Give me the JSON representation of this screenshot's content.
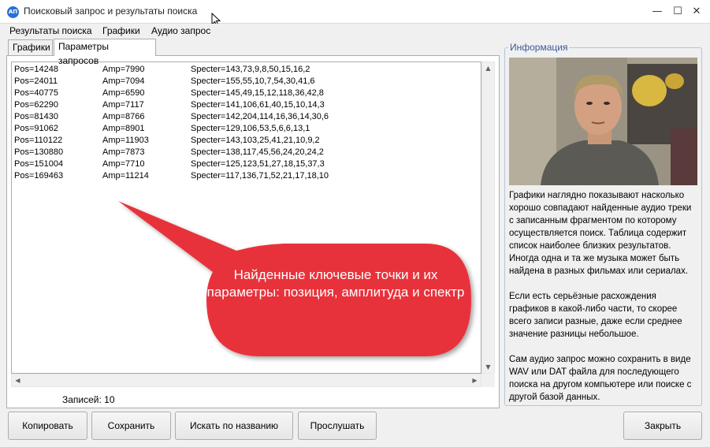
{
  "window": {
    "title": "Поисковый запрос и результаты поиска",
    "icon_text": "АП",
    "minimize_glyph": "—",
    "maximize_glyph": "☐",
    "close_glyph": "✕"
  },
  "menu": [
    "Результаты поиска",
    "Графики",
    "Аудио запрос"
  ],
  "tabs": [
    {
      "label": "Графики",
      "active": false
    },
    {
      "label": "Параметры запросов",
      "active": true
    }
  ],
  "results": [
    {
      "pos": "Pos=14248",
      "amp": "Amp=7990",
      "spec": "Specter=143,73,9,8,50,15,16,2"
    },
    {
      "pos": "Pos=24011",
      "amp": "Amp=7094",
      "spec": "Specter=155,55,10,7,54,30,41,6"
    },
    {
      "pos": "Pos=40775",
      "amp": "Amp=6590",
      "spec": "Specter=145,49,15,12,118,36,42,8"
    },
    {
      "pos": "Pos=62290",
      "amp": "Amp=7117",
      "spec": "Specter=141,106,61,40,15,10,14,3"
    },
    {
      "pos": "Pos=81430",
      "amp": "Amp=8766",
      "spec": "Specter=142,204,114,16,36,14,30,6"
    },
    {
      "pos": "Pos=91062",
      "amp": "Amp=8901",
      "spec": "Specter=129,106,53,5,6,6,13,1"
    },
    {
      "pos": "Pos=110122",
      "amp": "Amp=11903",
      "spec": "Specter=143,103,25,41,21,10,9,2"
    },
    {
      "pos": "Pos=130880",
      "amp": "Amp=7873",
      "spec": "Specter=138,117,45,56,24,20,24,2"
    },
    {
      "pos": "Pos=151004",
      "amp": "Amp=7710",
      "spec": "Specter=125,123,51,27,18,15,37,3"
    },
    {
      "pos": "Pos=169463",
      "amp": "Amp=11214",
      "spec": "Specter=117,136,71,52,21,17,18,10"
    }
  ],
  "records_label": "Записей: 10",
  "callout_text": "Найденные ключевые точки и их параметры: позиция, амплитуда и спектр",
  "callout_color": "#e8313a",
  "info": {
    "title": "Информация",
    "paragraphs": [
      "Графики наглядно показывают насколько хорошо совпадают найденные аудио треки с записанным фрагментом по которому осуществляется поиск. Таблица содержит список наиболее близких результатов. Иногда одна и та же музыка может быть найдена в разных фильмах или сериалах.",
      "Если есть серьёзные расхождения графиков в какой-либо части, то скорее всего записи разные, даже если среднее значение разницы небольшое.",
      "Сам аудио запрос можно сохранить в виде WAV или DAT файла для последующего поиска на другом компьютере или поиске с другой базой данных."
    ]
  },
  "buttons": {
    "copy": "Копировать",
    "save": "Сохранить",
    "search_by_name": "Искать по названию",
    "listen": "Прослушать",
    "close": "Закрыть"
  }
}
